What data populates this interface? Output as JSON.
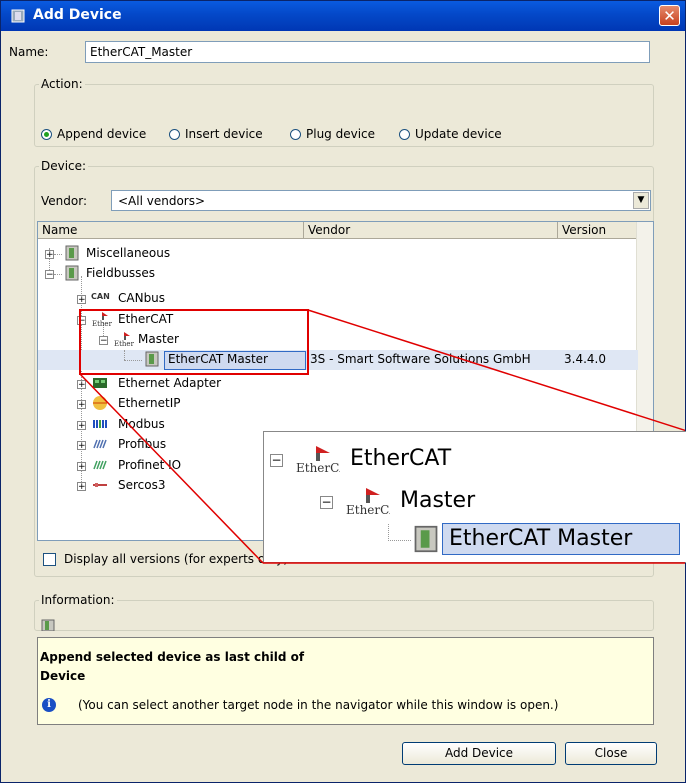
{
  "window": {
    "title": "Add Device"
  },
  "name_field": {
    "label": "Name:",
    "value": "EtherCAT_Master"
  },
  "action": {
    "legend": "Action:",
    "options": [
      {
        "label": "Append device",
        "selected": true
      },
      {
        "label": "Insert device",
        "selected": false
      },
      {
        "label": "Plug device",
        "selected": false
      },
      {
        "label": "Update device",
        "selected": false
      }
    ]
  },
  "device": {
    "legend": "Device:",
    "vendor_label": "Vendor:",
    "vendor_value": "<All vendors>",
    "columns": [
      "Name",
      "Vendor",
      "Version"
    ],
    "tree": [
      {
        "label": "Miscellaneous",
        "icon": "device-icon"
      },
      {
        "label": "Fieldbusses",
        "icon": "device-icon"
      },
      {
        "label": "CANbus",
        "icon": "can-icon"
      },
      {
        "label": "EtherCAT",
        "icon": "ethercat-icon"
      },
      {
        "label": "Master",
        "icon": "ethercat-icon"
      },
      {
        "label": "EtherCAT Master",
        "icon": "device-icon",
        "vendor": "3S - Smart Software Solutions GmbH",
        "version": "3.4.4.0",
        "selected": true
      },
      {
        "label": "Ethernet Adapter",
        "icon": "ethernet-adapter-icon"
      },
      {
        "label": "EthernetIP",
        "icon": "ethernetip-icon"
      },
      {
        "label": "Modbus",
        "icon": "modbus-icon"
      },
      {
        "label": "Profibus",
        "icon": "profibus-icon"
      },
      {
        "label": "Profinet IO",
        "icon": "profinet-icon"
      },
      {
        "label": "Sercos3",
        "icon": "sercos-icon"
      }
    ],
    "display_all_versions": "Display all versions (for experts only)"
  },
  "zoom_callout": {
    "rows": [
      {
        "label": "EtherCAT"
      },
      {
        "label": "Master"
      },
      {
        "label": "EtherCAT Master"
      }
    ]
  },
  "information": {
    "legend": "Information:"
  },
  "info_panel": {
    "line1": "Append selected device as last child of",
    "line2": "Device",
    "hint": "(You can select another target node in the navigator while this window is open.)"
  },
  "buttons": {
    "add_device": "Add Device",
    "close": "Close"
  },
  "colors": {
    "titlebar": "#0448c8",
    "selection": "#cfdaf0",
    "callout": "#e00000",
    "info_bg": "#ffffe1"
  }
}
